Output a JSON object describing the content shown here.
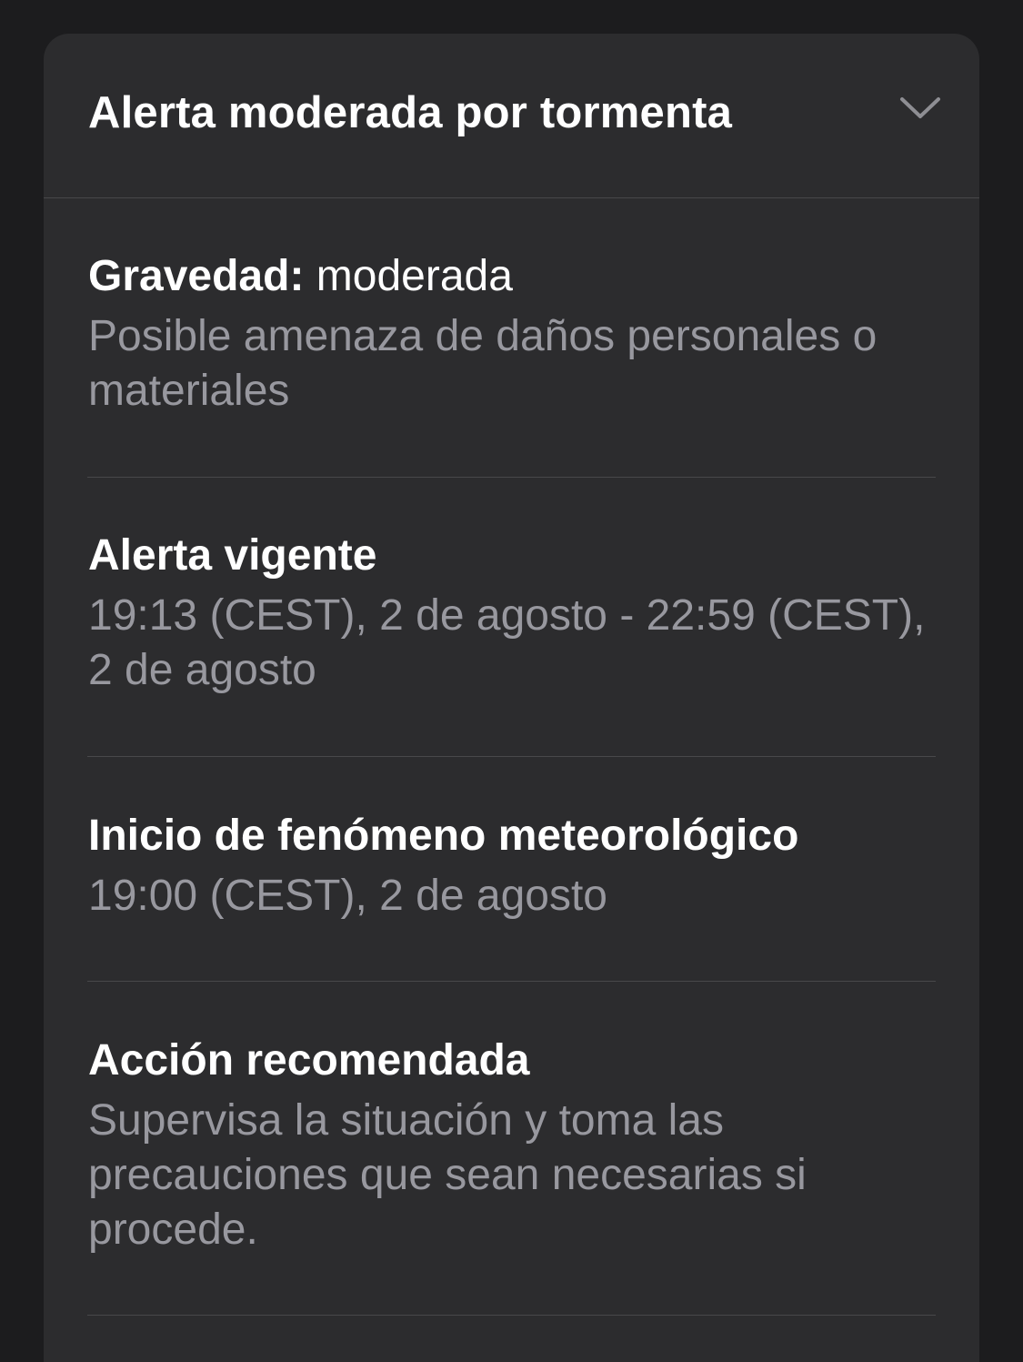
{
  "alert": {
    "title": "Alerta moderada por tormenta",
    "expand_icon": "chevron-down-icon"
  },
  "severity": {
    "label": "Gravedad:",
    "value": "moderada",
    "description": "Posible amenaza de daños personales o materiales"
  },
  "validity": {
    "title": "Alerta vigente",
    "range": "19:13 (CEST), 2 de agosto - 22:59 (CEST), 2 de agosto"
  },
  "onset": {
    "title": "Inicio de fenómeno meteorológico",
    "time": "19:00 (CEST), 2 de agosto"
  },
  "action": {
    "title": "Acción recomendada",
    "text": "Supervisa la situación y toma las precauciones que sean necesarias si procede."
  },
  "colors": {
    "background": "#1c1c1e",
    "card": "#2c2c2e",
    "primary_text": "#ffffff",
    "secondary_text": "#98989f",
    "separator": "#48484a"
  }
}
